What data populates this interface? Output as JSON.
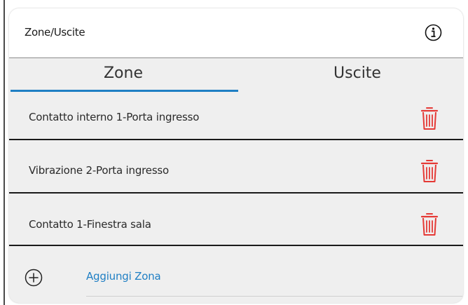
{
  "header": {
    "title": "Zone/Uscite",
    "info_icon": "info-icon"
  },
  "tabs": [
    {
      "label": "Zone",
      "active": true
    },
    {
      "label": "Uscite",
      "active": false
    }
  ],
  "zones": [
    {
      "label": "Contatto interno 1-Porta ingresso",
      "icon": "trash-icon"
    },
    {
      "label": "Vibrazione 2-Porta ingresso",
      "icon": "trash-icon"
    },
    {
      "label": "Contatto 1-Finestra sala",
      "icon": "trash-icon"
    }
  ],
  "add": {
    "label": "Aggiungi Zona",
    "icon": "plus-circle-icon"
  },
  "colors": {
    "accent": "#1f7fc4",
    "delete": "#e53935",
    "card_bg": "#efefef",
    "header_bg": "#ffffff"
  }
}
